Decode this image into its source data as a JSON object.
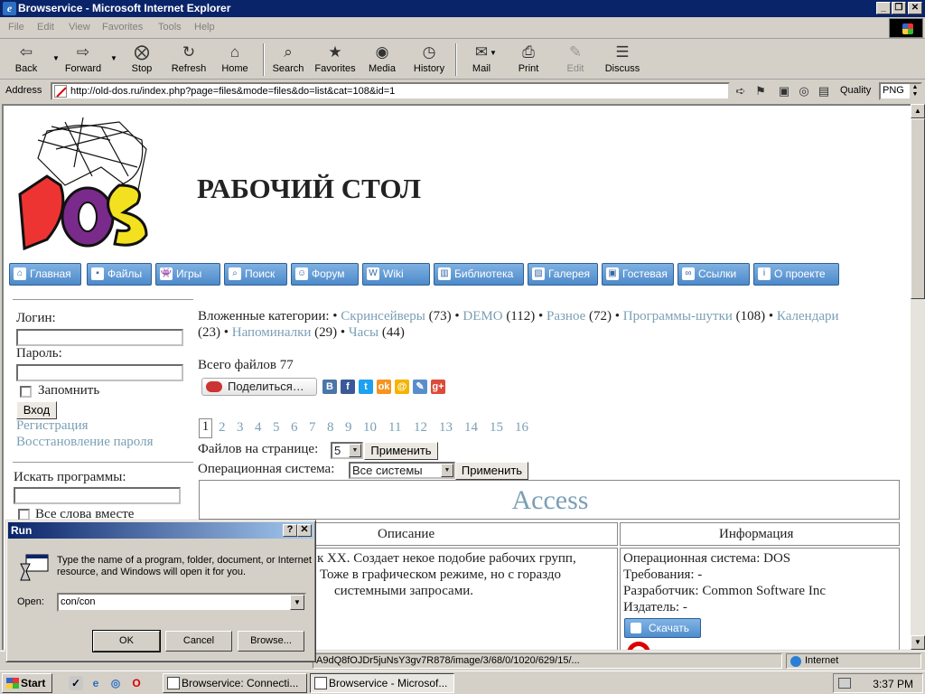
{
  "window": {
    "title": "Browservice - Microsoft Internet Explorer",
    "minimize": "_",
    "maximize": "❐",
    "close": "✕"
  },
  "menu": [
    "File",
    "Edit",
    "View",
    "Favorites",
    "Tools",
    "Help"
  ],
  "toolbar": {
    "back": "Back",
    "forward": "Forward",
    "stop": "Stop",
    "refresh": "Refresh",
    "home": "Home",
    "search": "Search",
    "favorites": "Favorites",
    "media": "Media",
    "history": "History",
    "mail": "Mail",
    "print": "Print",
    "edit": "Edit",
    "discuss": "Discuss"
  },
  "address": {
    "label": "Address",
    "url": "http://old-dos.ru/index.php?page=files&mode=files&do=list&cat=108&id=1",
    "quality_label": "Quality",
    "quality_value": "PNG"
  },
  "page": {
    "heading": "РАБОЧИЙ СТОЛ",
    "nav": [
      "Главная",
      "Файлы",
      "Игры",
      "Поиск",
      "Форум",
      "Wiki",
      "Библиотека",
      "Галерея",
      "Гостевая",
      "Ссылки",
      "О проекте"
    ],
    "login": {
      "login_label": "Логин:",
      "password_label": "Пароль:",
      "remember_label": "Запомнить",
      "submit": "Вход",
      "register": "Регистрация",
      "restore": "Восстановление пароля"
    },
    "search": {
      "label": "Искать программы:",
      "all_words": "Все слова вместе"
    },
    "categories": {
      "prefix": "Вложенные категории: •",
      "items": [
        {
          "name": "Скринсейверы",
          "count": "(73) •"
        },
        {
          "name": "DEMO",
          "count": "(112) •"
        },
        {
          "name": "Разное",
          "count": "(72) •"
        },
        {
          "name": "Программы-шутки",
          "count": "(108) •"
        },
        {
          "name": "Календари",
          "count": ""
        },
        {
          "name": "Напоминалки",
          "count": "(29) •"
        },
        {
          "name": "Часы",
          "count": "(44)"
        }
      ],
      "calendar_count": "(23) •"
    },
    "total_files": "Всего файлов 77",
    "share_label": "Поделиться…",
    "pages": [
      "1",
      "2",
      "3",
      "4",
      "5",
      "6",
      "7",
      "8",
      "9",
      "10",
      "11",
      "12",
      "13",
      "14",
      "15",
      "16"
    ],
    "per_page_label": "Файлов на странице:",
    "per_page_value": "5",
    "apply": "Применить",
    "os_label": "Операционная система:",
    "os_value": "Все системы",
    "item_title": "Access",
    "col_description": "Описание",
    "col_info": "Информация",
    "description_lines": [
      "к XX. Создает некое подобие рабочих групп,",
      "Тоже в графическом режиме, но с гораздо",
      "системными запросами."
    ],
    "info": {
      "os": "Операционная система: DOS",
      "req": "Требования: -",
      "dev": "Разработчик: Common Software Inc",
      "pub": "Издатель: -",
      "download": "Скачать"
    }
  },
  "status": {
    "text": "A9dQ8fOJDr5juNsY3gv7R878/image/3/68/0/1020/629/15/...",
    "zone": "Internet"
  },
  "taskbar": {
    "start": "Start",
    "tasks": [
      "Browservice: Connecti...",
      "Browservice - Microsof..."
    ],
    "clock": "3:37 PM"
  },
  "run_dialog": {
    "title": "Run",
    "help": "?",
    "close": "✕",
    "description": "Type the name of a program, folder, document, or Internet resource, and Windows will open it for you.",
    "open_label": "Open:",
    "open_value": "con/con",
    "ok": "OK",
    "cancel": "Cancel",
    "browse": "Browse..."
  },
  "colors": {
    "titlebar": "#0a246a",
    "link": "#7a9fb5",
    "nav_button": "#4d8acb"
  }
}
